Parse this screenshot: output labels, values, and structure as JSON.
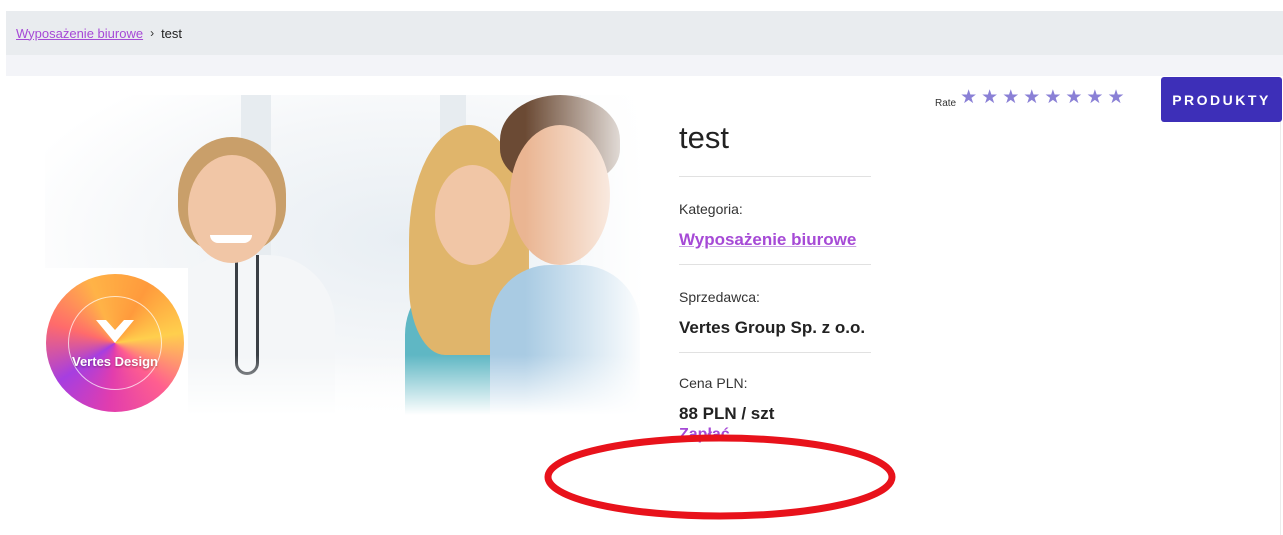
{
  "breadcrumb": {
    "category": "Wyposażenie biurowe",
    "separator": "›",
    "current": "test"
  },
  "product": {
    "title": "test",
    "category_label": "Kategoria:",
    "category_value": "Wyposażenie biurowe",
    "seller_label": "Sprzedawca:",
    "seller_value": "Vertes Group Sp. z o.o.",
    "price_label": "Cena PLN:",
    "price_value": "88 PLN / szt",
    "pay_link": "Zapłać"
  },
  "rating": {
    "label": "Rate",
    "stars_total": 8,
    "star_color": "#8a80d6"
  },
  "header_button": {
    "label": "PRODUKTY",
    "color": "#3d2fb8"
  },
  "logo": {
    "text": "Vertes Design"
  },
  "colors": {
    "link": "#a64ad6",
    "breadcrumb_bg": "#e9ecef",
    "annotation": "#e8121b"
  }
}
